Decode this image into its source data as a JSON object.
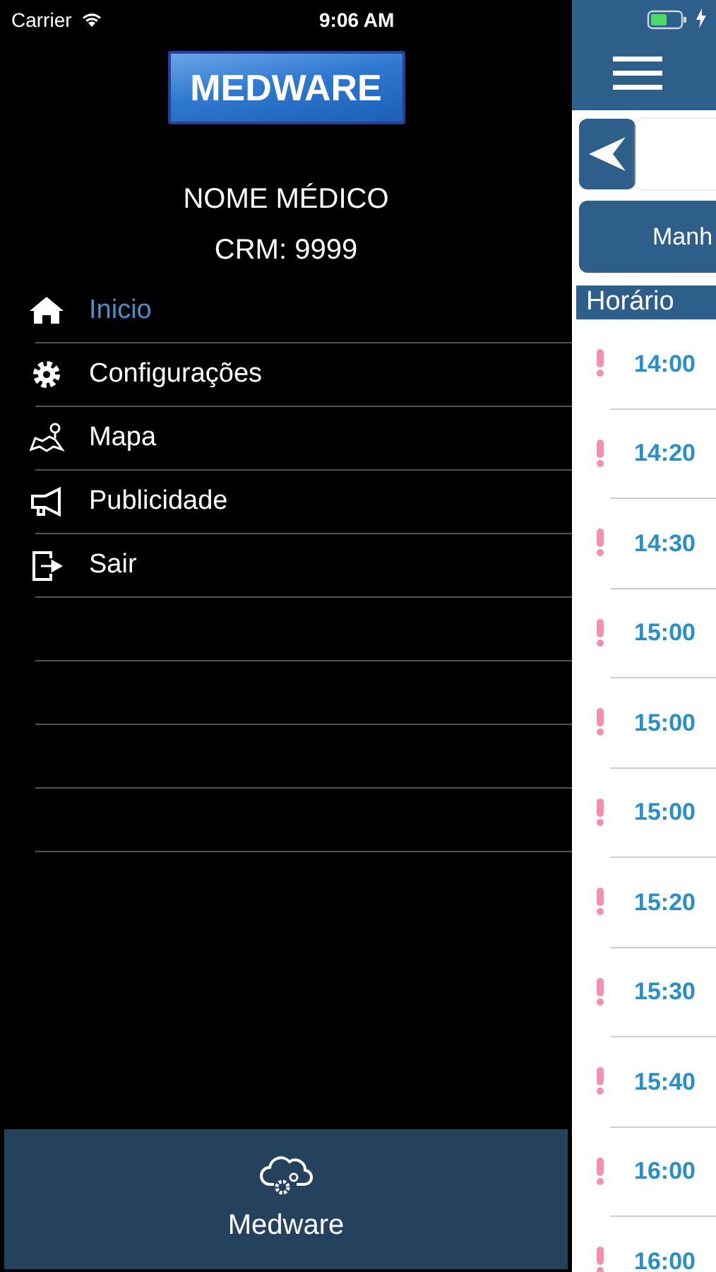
{
  "status_bar": {
    "carrier": "Carrier",
    "time": "9:06 AM"
  },
  "drawer": {
    "logo": "MEDWARE",
    "doctor_name": "NOME MÉDICO",
    "crm": "CRM: 9999",
    "menu": [
      {
        "label": "Inicio",
        "selected": true
      },
      {
        "label": "Configurações",
        "selected": false
      },
      {
        "label": "Mapa",
        "selected": false
      },
      {
        "label": "Publicidade",
        "selected": false
      },
      {
        "label": "Sair",
        "selected": false
      }
    ],
    "footer": {
      "label": "Medware"
    }
  },
  "schedule": {
    "period_button": "Manh",
    "column_header": "Horário",
    "rows": [
      {
        "time": "14:00"
      },
      {
        "time": "14:20"
      },
      {
        "time": "14:30"
      },
      {
        "time": "15:00"
      },
      {
        "time": "15:00"
      },
      {
        "time": "15:00"
      },
      {
        "time": "15:20"
      },
      {
        "time": "15:30"
      },
      {
        "time": "15:40"
      },
      {
        "time": "16:00"
      },
      {
        "time": "16:00"
      }
    ]
  }
}
